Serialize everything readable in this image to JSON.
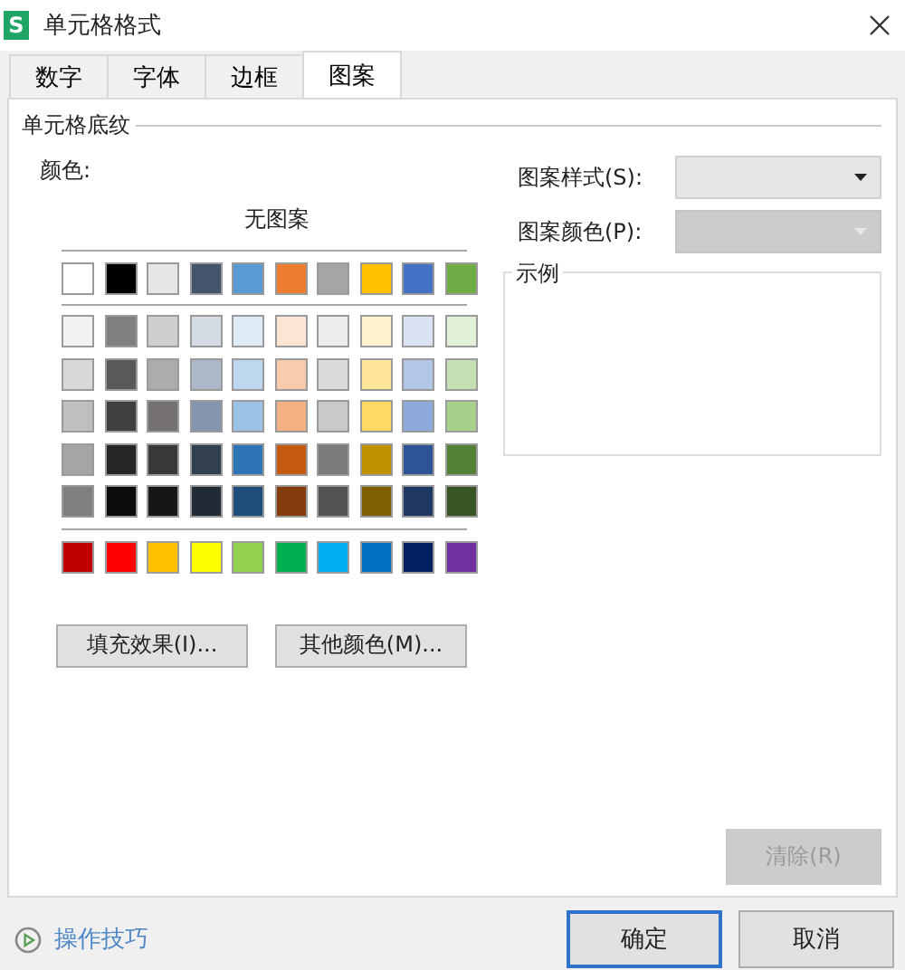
{
  "window": {
    "title": "单元格格式",
    "logo": "S"
  },
  "tabs": [
    {
      "label": "数字",
      "selected": false
    },
    {
      "label": "字体",
      "selected": false
    },
    {
      "label": "边框",
      "selected": false
    },
    {
      "label": "图案",
      "selected": true
    }
  ],
  "shading": {
    "title": "单元格底纹",
    "color_label": "颜色:",
    "no_pattern": "无图案",
    "theme_row": [
      {
        "color": "#ffffff"
      },
      {
        "color": "#000000"
      },
      {
        "color": "#e7e6e6"
      },
      {
        "color": "#44546a"
      },
      {
        "color": "#5b9bd5"
      },
      {
        "color": "#ed7d31"
      },
      {
        "color": "#a5a5a5"
      },
      {
        "color": "#ffc000"
      },
      {
        "color": "#4472c4"
      },
      {
        "color": "#70ad47"
      }
    ],
    "shade_rows": [
      [
        {
          "color": "#f2f2f2"
        },
        {
          "color": "#7f7f7f"
        },
        {
          "color": "#d0cece"
        },
        {
          "color": "#d6dce4"
        },
        {
          "color": "#deebf6"
        },
        {
          "color": "#fbe5d5"
        },
        {
          "color": "#ededed"
        },
        {
          "color": "#fff2cc"
        },
        {
          "color": "#dae3f3"
        },
        {
          "color": "#e2efd9"
        }
      ],
      [
        {
          "color": "#d8d8d8"
        },
        {
          "color": "#595959"
        },
        {
          "color": "#aeabab"
        },
        {
          "color": "#adb9ca"
        },
        {
          "color": "#bdd7ee"
        },
        {
          "color": "#f7cbac"
        },
        {
          "color": "#dbdbdb"
        },
        {
          "color": "#fee599"
        },
        {
          "color": "#b4c6e7"
        },
        {
          "color": "#c5e0b3"
        }
      ],
      [
        {
          "color": "#bfbfbf"
        },
        {
          "color": "#3f3f3f"
        },
        {
          "color": "#757070"
        },
        {
          "color": "#8496b0"
        },
        {
          "color": "#9cc3e5"
        },
        {
          "color": "#f4b183"
        },
        {
          "color": "#c9c9c9"
        },
        {
          "color": "#ffd965"
        },
        {
          "color": "#8eaadb"
        },
        {
          "color": "#a8d08d"
        }
      ],
      [
        {
          "color": "#a5a5a5"
        },
        {
          "color": "#262626"
        },
        {
          "color": "#3a3838"
        },
        {
          "color": "#323f4f"
        },
        {
          "color": "#2e75b5"
        },
        {
          "color": "#c55a11"
        },
        {
          "color": "#7b7b7b"
        },
        {
          "color": "#bf9000"
        },
        {
          "color": "#2f5496"
        },
        {
          "color": "#538135"
        }
      ],
      [
        {
          "color": "#7f7f7f"
        },
        {
          "color": "#0c0c0c"
        },
        {
          "color": "#171616"
        },
        {
          "color": "#222a35"
        },
        {
          "color": "#1e4e79"
        },
        {
          "color": "#833c0b"
        },
        {
          "color": "#525252"
        },
        {
          "color": "#7f6000"
        },
        {
          "color": "#1f3864"
        },
        {
          "color": "#375623"
        }
      ]
    ],
    "standard_row": [
      {
        "color": "#c00000"
      },
      {
        "color": "#ff0000"
      },
      {
        "color": "#ffc000"
      },
      {
        "color": "#ffff00"
      },
      {
        "color": "#92d050"
      },
      {
        "color": "#00b050"
      },
      {
        "color": "#00b0f0"
      },
      {
        "color": "#0070c0"
      },
      {
        "color": "#002060"
      },
      {
        "color": "#7030a0"
      }
    ],
    "buttons": [
      "填充效果(I)...",
      "其他颜色(M)..."
    ]
  },
  "pattern_fields": [
    {
      "label": "图案样式(S):",
      "disabled": false
    },
    {
      "label": "图案颜色(P):",
      "disabled": true
    }
  ],
  "sample": {
    "title": "示例"
  },
  "clear_button": {
    "label": "清除(R)",
    "disabled": true
  },
  "footer": {
    "tips_link": "操作技巧",
    "buttons": [
      {
        "label": "确定",
        "focused": true
      },
      {
        "label": "取消",
        "focused": false
      }
    ]
  }
}
